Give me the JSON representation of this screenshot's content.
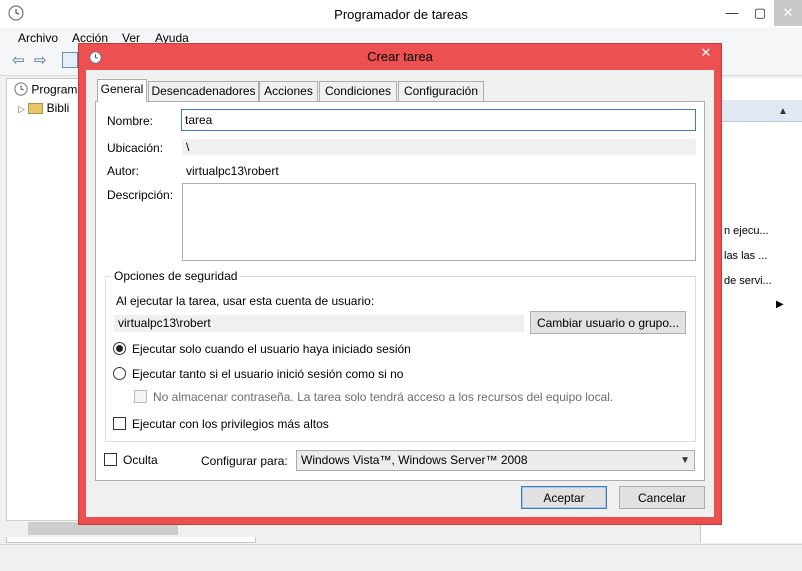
{
  "main_window": {
    "title": "Programador de tareas",
    "menu": [
      "Archivo",
      "Acción",
      "Ver",
      "Ayuda"
    ],
    "tree": [
      {
        "label": "Program",
        "icon": "clock-icon"
      },
      {
        "label": "Bibli",
        "icon": "folder-icon"
      }
    ],
    "actions": [
      "n ejecu...",
      "las las ...",
      "de servi..."
    ]
  },
  "dialog": {
    "title": "Crear tarea",
    "close_glyph": "✕",
    "tabs": [
      {
        "label": "General",
        "active": true
      },
      {
        "label": "Desencadenadores",
        "active": false
      },
      {
        "label": "Acciones",
        "active": false
      },
      {
        "label": "Condiciones",
        "active": false
      },
      {
        "label": "Configuración",
        "active": false
      }
    ],
    "fields": {
      "name_label": "Nombre:",
      "name_value": "tarea",
      "location_label": "Ubicación:",
      "location_value": "\\",
      "author_label": "Autor:",
      "author_value": "virtualpc13\\robert",
      "description_label": "Descripción:",
      "description_value": ""
    },
    "security": {
      "legend": "Opciones de seguridad",
      "account_prompt": "Al ejecutar la tarea, usar esta cuenta de usuario:",
      "account_value": "virtualpc13\\robert",
      "change_user_button": "Cambiar usuario o grupo...",
      "radio_logged_on": "Ejecutar solo cuando el usuario haya iniciado sesión",
      "radio_logged_on_selected": true,
      "radio_whether": "Ejecutar tanto si el usuario inició sesión como si no",
      "radio_whether_selected": false,
      "no_store_password": "No almacenar contraseña. La tarea solo tendrá acceso a los recursos del equipo local.",
      "highest_privileges": "Ejecutar con los privilegios más altos"
    },
    "hidden_label": "Oculta",
    "configure_label": "Configurar para:",
    "configure_value": "Windows Vista™, Windows Server™ 2008",
    "ok_button": "Aceptar",
    "cancel_button": "Cancelar"
  },
  "colors": {
    "dialog_frame": "#ec5050",
    "focus_border": "#3c7fb1"
  }
}
